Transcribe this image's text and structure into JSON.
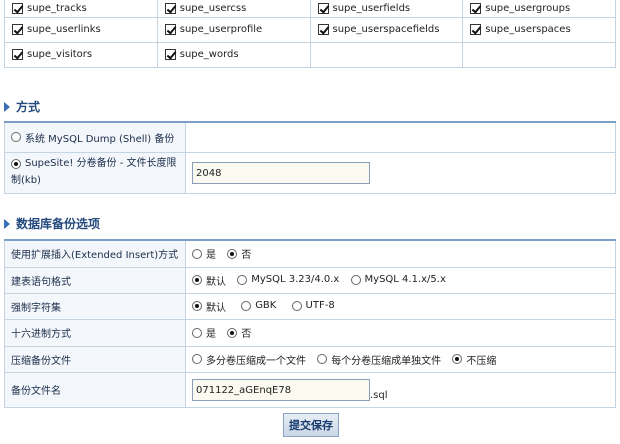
{
  "tables": [
    [
      "supe_tracks",
      "supe_usercss",
      "supe_userfields",
      "supe_usergroups"
    ],
    [
      "supe_userlinks",
      "supe_userprofile",
      "supe_userspacefields",
      "supe_userspaces"
    ],
    [
      "supe_visitors",
      "supe_words"
    ]
  ],
  "method_section": {
    "title": "方式",
    "option_shell": "系统 MySQL Dump (Shell) 备份",
    "option_supesite": "SupeSite! 分卷备份 - 文件长度限制(kb)",
    "volume_limit": "2048"
  },
  "options_section": {
    "title": "数据库备份选项",
    "extended_insert": {
      "label": "使用扩展插入(Extended Insert)方式",
      "yes": "是",
      "no": "否",
      "selected": "否"
    },
    "create_syntax": {
      "label": "建表语句格式",
      "opt_default": "默认",
      "opt_mysql323": "MySQL 3.23/4.0.x",
      "opt_mysql41": "MySQL 4.1.x/5.x",
      "selected": "默认"
    },
    "charset": {
      "label": "强制字符集",
      "opt_default": "默认",
      "opt_gbk": "GBK",
      "opt_utf8": "UTF-8",
      "selected": "默认"
    },
    "hex": {
      "label": "十六进制方式",
      "yes": "是",
      "no": "否",
      "selected": "否"
    },
    "compress": {
      "label": "压缩备份文件",
      "opt_multi_one": "多分卷压缩成一个文件",
      "opt_each": "每个分卷压缩成单独文件",
      "opt_none": "不压缩",
      "selected": "不压缩"
    },
    "filename": {
      "label": "备份文件名",
      "value": "071122_aGEnqE78",
      "suffix": ".sql"
    }
  },
  "submit_label": "提交保存",
  "colors": {
    "accent": "#3a6fb3",
    "border": "#c5d4e3",
    "input_bg": "#fbfaf0"
  }
}
